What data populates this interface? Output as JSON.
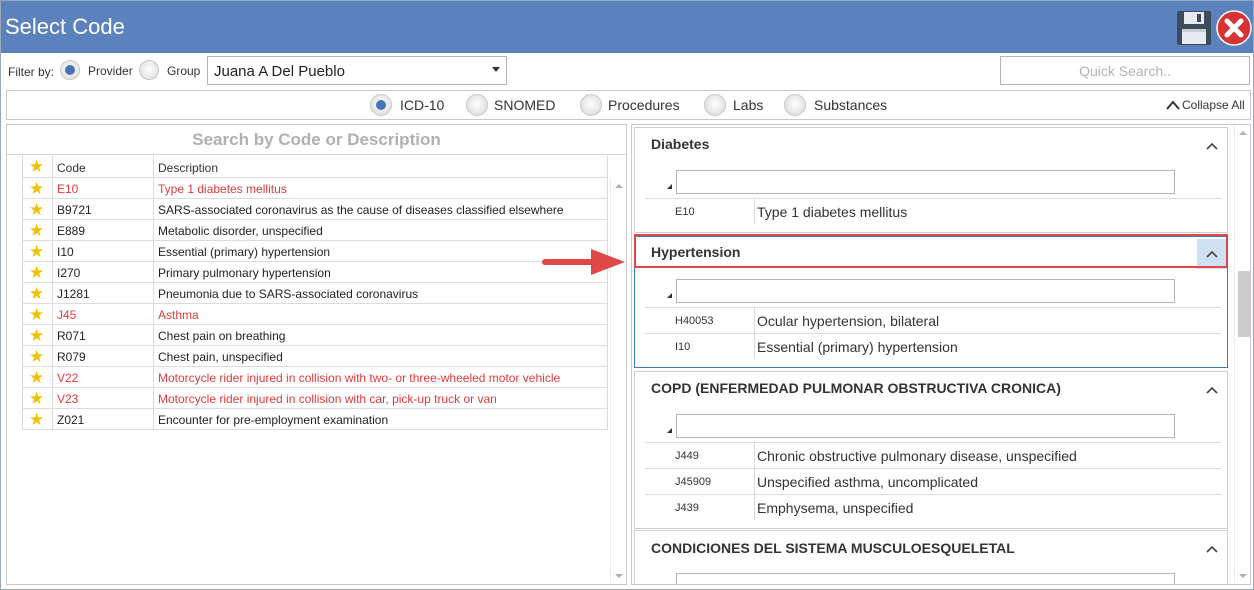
{
  "window": {
    "title": "Select Code"
  },
  "filter": {
    "label": "Filter by:",
    "options": [
      {
        "label": "Provider",
        "selected": true
      },
      {
        "label": "Group",
        "selected": false
      }
    ],
    "provider_value": "Juana A Del Pueblo",
    "quick_search_placeholder": "Quick Search.."
  },
  "code_types": [
    {
      "label": "ICD-10",
      "selected": true
    },
    {
      "label": "SNOMED",
      "selected": false
    },
    {
      "label": "Procedures",
      "selected": false
    },
    {
      "label": "Labs",
      "selected": false
    },
    {
      "label": "Substances",
      "selected": false
    }
  ],
  "collapse_all_label": "Collapse All",
  "left": {
    "search_placeholder": "Search by Code or Description",
    "columns": {
      "code": "Code",
      "description": "Description"
    },
    "rows": [
      {
        "code": "E10",
        "description": "Type 1 diabetes mellitus",
        "highlight": true
      },
      {
        "code": "B9721",
        "description": "SARS-associated coronavirus as the cause of diseases classified elsewhere",
        "highlight": false
      },
      {
        "code": "E889",
        "description": "Metabolic disorder, unspecified",
        "highlight": false
      },
      {
        "code": "I10",
        "description": "Essential (primary) hypertension",
        "highlight": false
      },
      {
        "code": "I270",
        "description": "Primary pulmonary hypertension",
        "highlight": false
      },
      {
        "code": "J1281",
        "description": "Pneumonia due to SARS-associated coronavirus",
        "highlight": false
      },
      {
        "code": "J45",
        "description": "Asthma",
        "highlight": true
      },
      {
        "code": "R071",
        "description": "Chest pain on breathing",
        "highlight": false
      },
      {
        "code": "R079",
        "description": "Chest pain, unspecified",
        "highlight": false
      },
      {
        "code": "V22",
        "description": "Motorcycle rider injured in collision with two- or three-wheeled motor vehicle",
        "highlight": true
      },
      {
        "code": "V23",
        "description": "Motorcycle rider injured in collision with car, pick-up truck or van",
        "highlight": true
      },
      {
        "code": "Z021",
        "description": "Encounter for pre-employment examination",
        "highlight": false
      }
    ]
  },
  "groups": [
    {
      "title": "Diabetes",
      "rows": [
        {
          "code": "E10",
          "description": "Type 1 diabetes mellitus",
          "highlight": true
        }
      ]
    },
    {
      "title": "Hypertension",
      "rows": [
        {
          "code": "H40053",
          "description": "Ocular hypertension, bilateral",
          "highlight": false
        },
        {
          "code": "I10",
          "description": "Essential (primary) hypertension",
          "highlight": false
        }
      ]
    },
    {
      "title": "COPD (ENFERMEDAD PULMONAR OBSTRUCTIVA CRONICA)",
      "rows": [
        {
          "code": "J449",
          "description": "Chronic obstructive pulmonary disease, unspecified",
          "highlight": false
        },
        {
          "code": "J45909",
          "description": "Unspecified asthma, uncomplicated",
          "highlight": false
        },
        {
          "code": "J439",
          "description": "Emphysema, unspecified",
          "highlight": false
        }
      ]
    },
    {
      "title": "CONDICIONES DEL SISTEMA MUSCULOESQUELETAL",
      "rows": []
    }
  ],
  "colors": {
    "titlebar": "#5b82bc",
    "accent_radio": "#4a74b5",
    "highlight_text": "#e23b3b",
    "star": "#f2c200",
    "callout": "#e04848"
  }
}
